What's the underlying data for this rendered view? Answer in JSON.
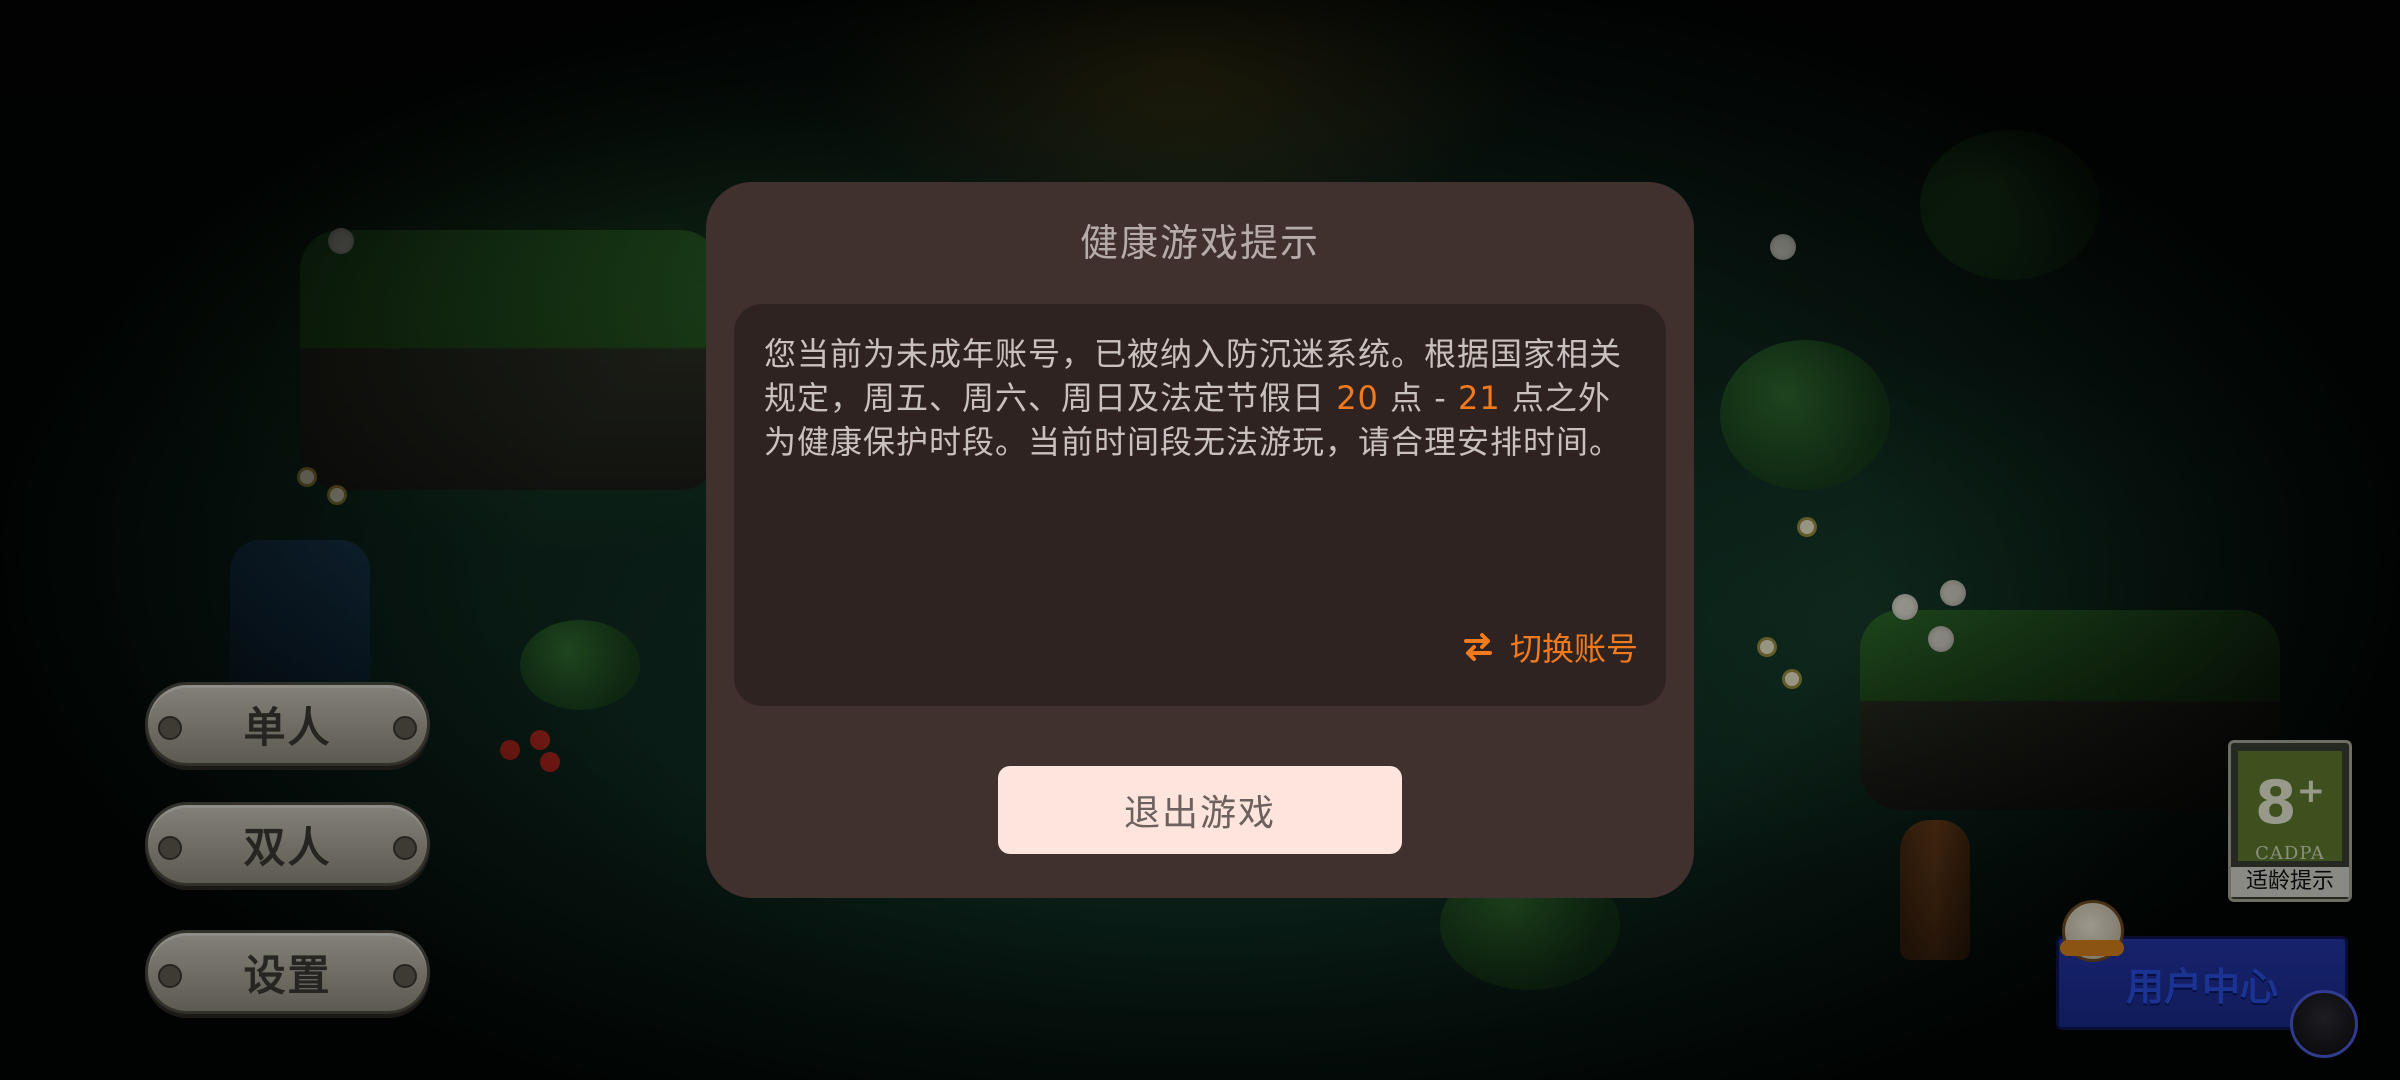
{
  "game_menu": {
    "single_label": "单人",
    "double_label": "双人",
    "settings_label": "设置"
  },
  "age_rating": {
    "rating": "8",
    "plus": "+",
    "org": "CADPA",
    "caption": "适龄提示"
  },
  "user_center": {
    "label": "用户中心"
  },
  "dialog": {
    "title": "健康游戏提示",
    "message_part1": "您当前为未成年账号，已被纳入防沉迷系统。根据国家相关规定，周五、周六、周日及法定节假日 ",
    "start_hour": "20",
    "message_part2": " 点 - ",
    "end_hour": "21",
    "message_part3": " 点之外为健康保护时段。当前时间段无法游玩，请合理安排时间。",
    "switch_account_label": "切换账号",
    "exit_button_label": "退出游戏"
  },
  "colors": {
    "highlight": "#f07a1d",
    "dialog_bg": "#40302e",
    "dialog_body_bg": "#2f2322",
    "exit_button_bg": "#fde4dc"
  },
  "icons": {
    "switch_account": "swap-arrows-icon"
  }
}
